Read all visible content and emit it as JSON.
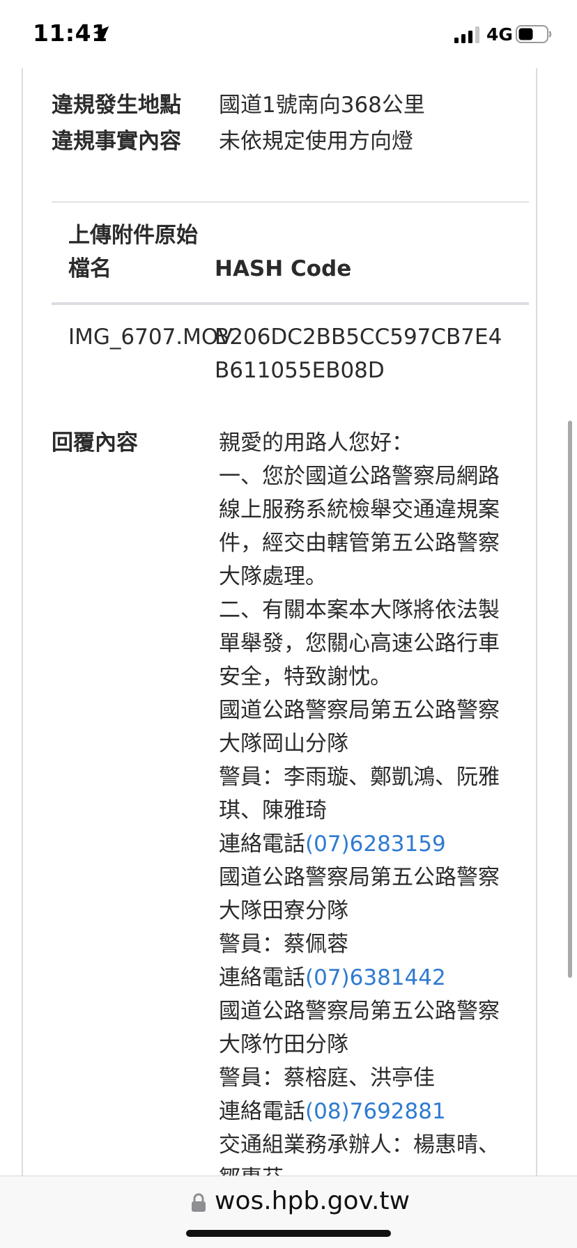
{
  "status_bar": {
    "time": "11:41",
    "network": "4G"
  },
  "details": [
    {
      "label": "違規發生地點",
      "value": "國道1號南向368公里"
    },
    {
      "label": "違規事實內容",
      "value": "未依規定使用方向燈"
    }
  ],
  "attachments_table": {
    "headers": [
      "上傳附件原始檔名",
      "HASH Code"
    ],
    "rows": [
      {
        "filename": "IMG_6707.MOV",
        "hash": "B206DC2BB5CC597CB7E4B611055EB08D"
      }
    ]
  },
  "reply": {
    "label": "回覆內容",
    "lines": [
      "親愛的用路人您好：",
      "一、您於國道公路警察局網路",
      "線上服務系統檢舉交通違規案",
      "件，經交由轄管第五公路警察",
      "大隊處理。",
      "二、有關本案本大隊將依法製",
      "單舉發，您關心高速公路行車",
      "安全，特致謝忱。",
      "國道公路警察局第五公路警察",
      "大隊岡山分隊",
      "警員：李雨璇、鄭凱鴻、阮雅",
      "琪、陳雅琦",
      "國道公路警察局第五公路警察",
      "大隊田寮分隊",
      "警員：蔡佩蓉",
      "國道公路警察局第五公路警察",
      "大隊竹田分隊",
      "警員：蔡榕庭、洪亭佳",
      "交通組業務承辦人：楊惠晴、",
      "鄒惠芬"
    ],
    "phone_prefix": "連絡電話",
    "phones": [
      "(07)6283159",
      "(07)6381442",
      "(08)7692881"
    ]
  },
  "browser": {
    "url": "wos.hpb.gov.tw"
  }
}
